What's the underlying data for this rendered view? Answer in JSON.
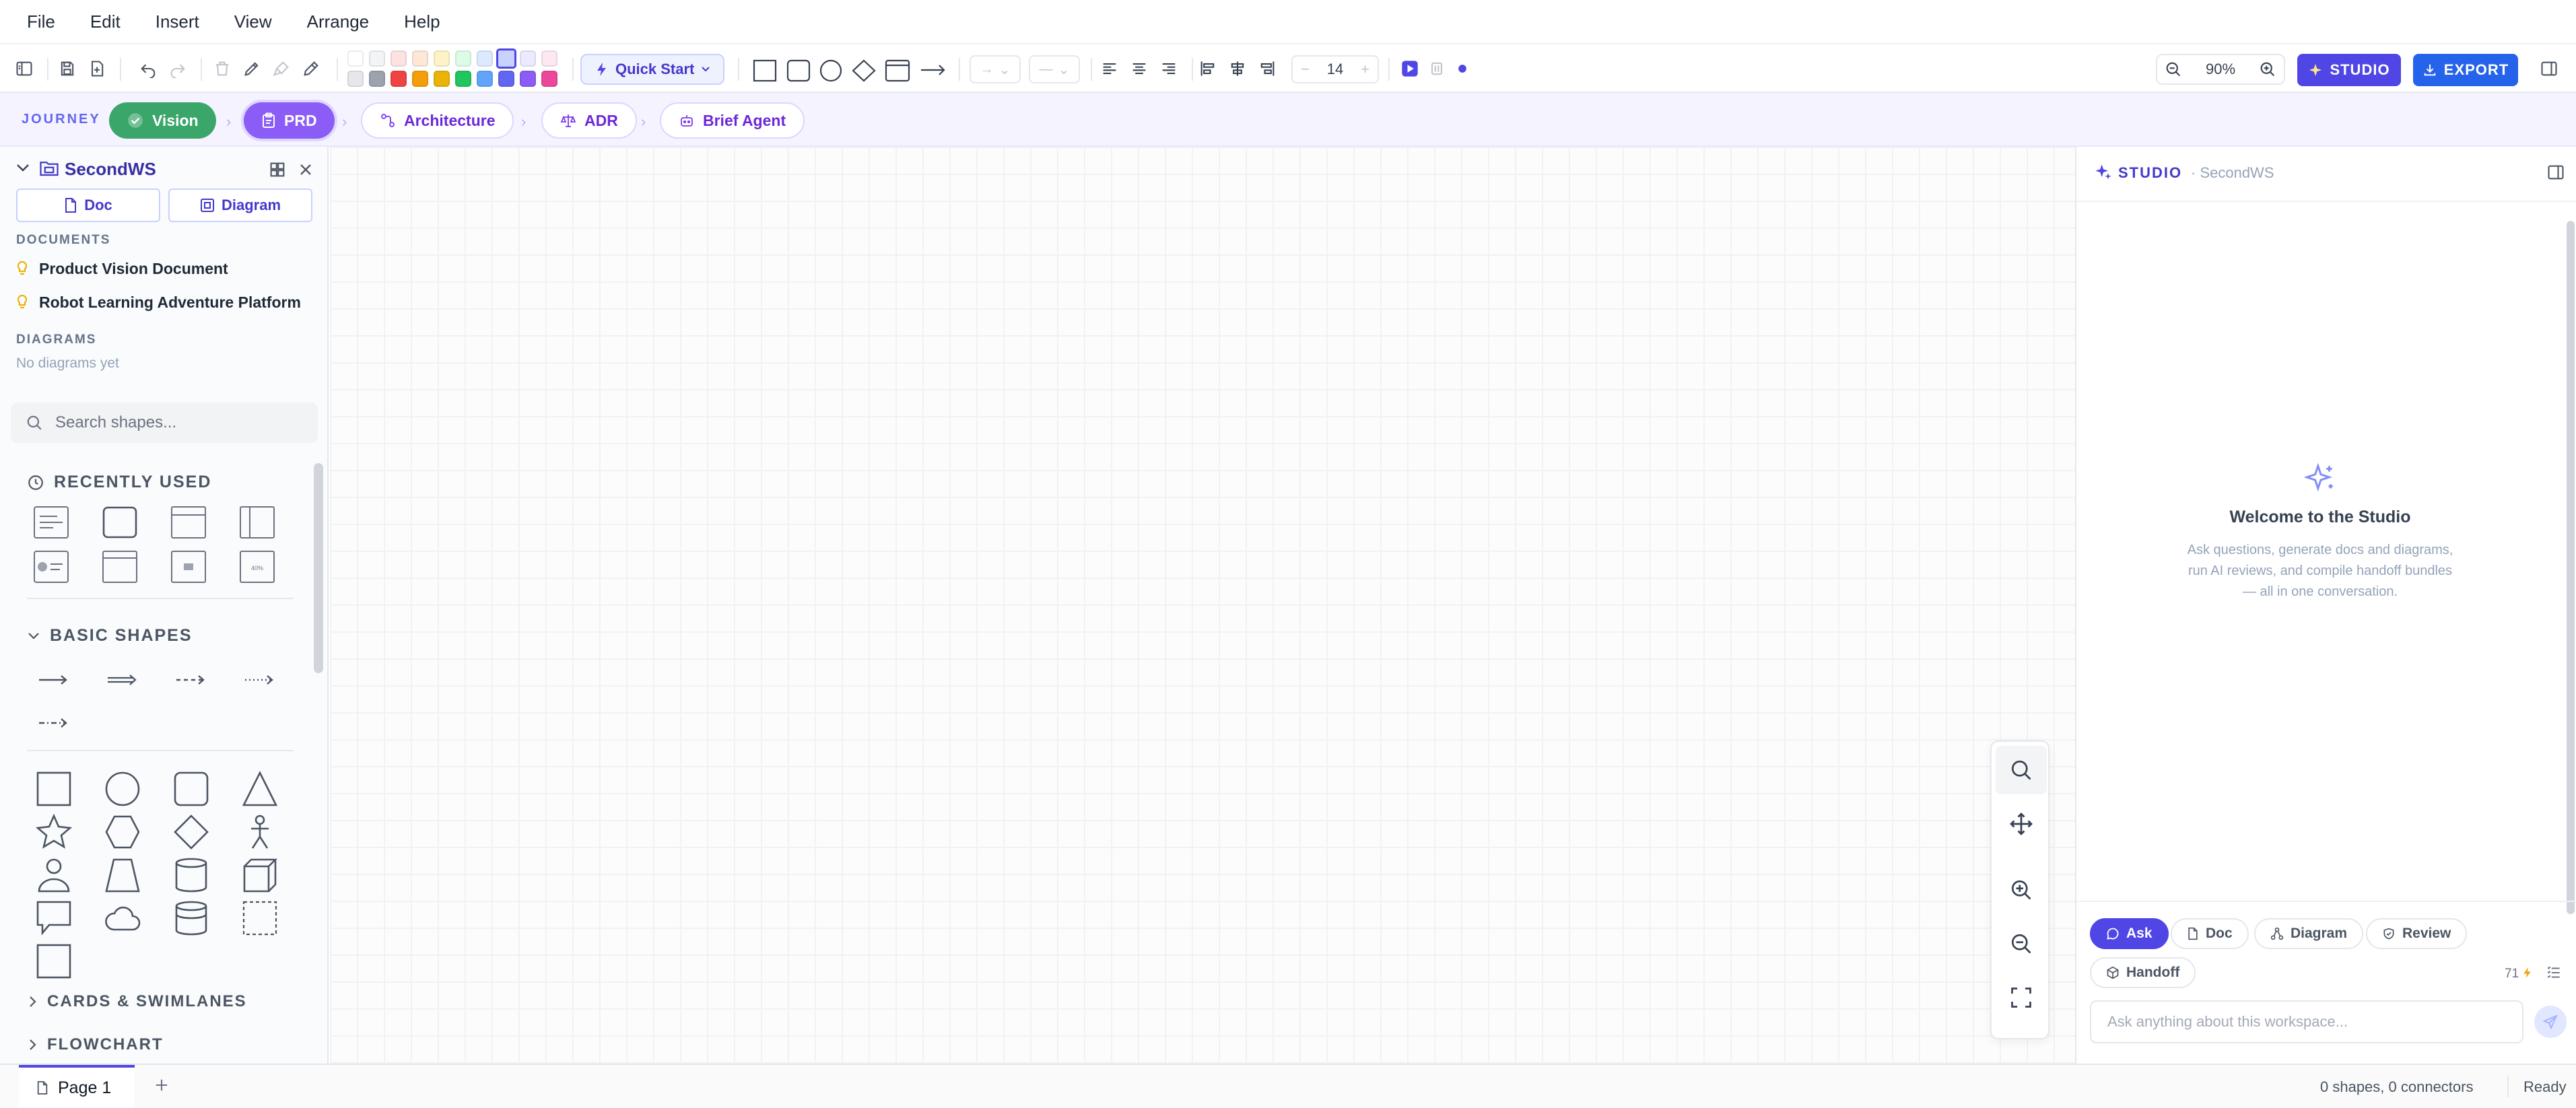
{
  "menu": [
    "File",
    "Edit",
    "Insert",
    "View",
    "Arrange",
    "Help"
  ],
  "toolbar": {
    "quick_start": "Quick Start",
    "font_size": "14",
    "zoom": "90%",
    "studio_label": "STUDIO",
    "export_label": "EXPORT",
    "swatches_top": [
      "#ffffff",
      "#f3f4f6",
      "#fde2e2",
      "#fde8d7",
      "#fef3c7",
      "#dcfce7",
      "#dbeafe",
      "#c7d2fe",
      "#ede9fe",
      "#fce7f3"
    ],
    "swatches_bottom": [
      "#e5e7eb",
      "#9ca3af",
      "#ef4444",
      "#f59e0b",
      "#eab308",
      "#22c55e",
      "#60a5fa",
      "#6366f1",
      "#8b5cf6",
      "#ec4899"
    ],
    "accent": "#4f46e5",
    "export_color": "#2563eb"
  },
  "journey": {
    "label": "JOURNEY",
    "steps": [
      {
        "label": "Vision",
        "state": "done"
      },
      {
        "label": "PRD",
        "state": "active"
      },
      {
        "label": "Architecture",
        "state": "todo"
      },
      {
        "label": "ADR",
        "state": "todo"
      },
      {
        "label": "Brief Agent",
        "state": "todo"
      }
    ]
  },
  "sidebar": {
    "workspace": "SecondWS",
    "doc_button": "Doc",
    "diagram_button": "Diagram",
    "documents_label": "DOCUMENTS",
    "documents": [
      "Product Vision Document",
      "Robot Learning Adventure Platform"
    ],
    "diagrams_label": "DIAGRAMS",
    "no_diagrams": "No diagrams yet",
    "search_placeholder": "Search shapes...",
    "recently_used": "RECENTLY USED",
    "basic_shapes": "BASIC SHAPES",
    "cards_swimlanes": "CARDS & SWIMLANES",
    "flowchart": "FLOWCHART",
    "recent_percent": "40%"
  },
  "studio": {
    "title": "STUDIO",
    "workspace": "· SecondWS",
    "welcome_title": "Welcome to the Studio",
    "welcome_line1": "Ask questions, generate docs and diagrams,",
    "welcome_line2": "run AI reviews, and compile handoff bundles",
    "welcome_line3": "— all in one conversation.",
    "modes": [
      "Ask",
      "Doc",
      "Diagram",
      "Review",
      "Handoff"
    ],
    "credits": "71",
    "input_placeholder": "Ask anything about this workspace..."
  },
  "status": {
    "page_tab": "Page 1",
    "counts": "0 shapes, 0 connectors",
    "state": "Ready"
  }
}
